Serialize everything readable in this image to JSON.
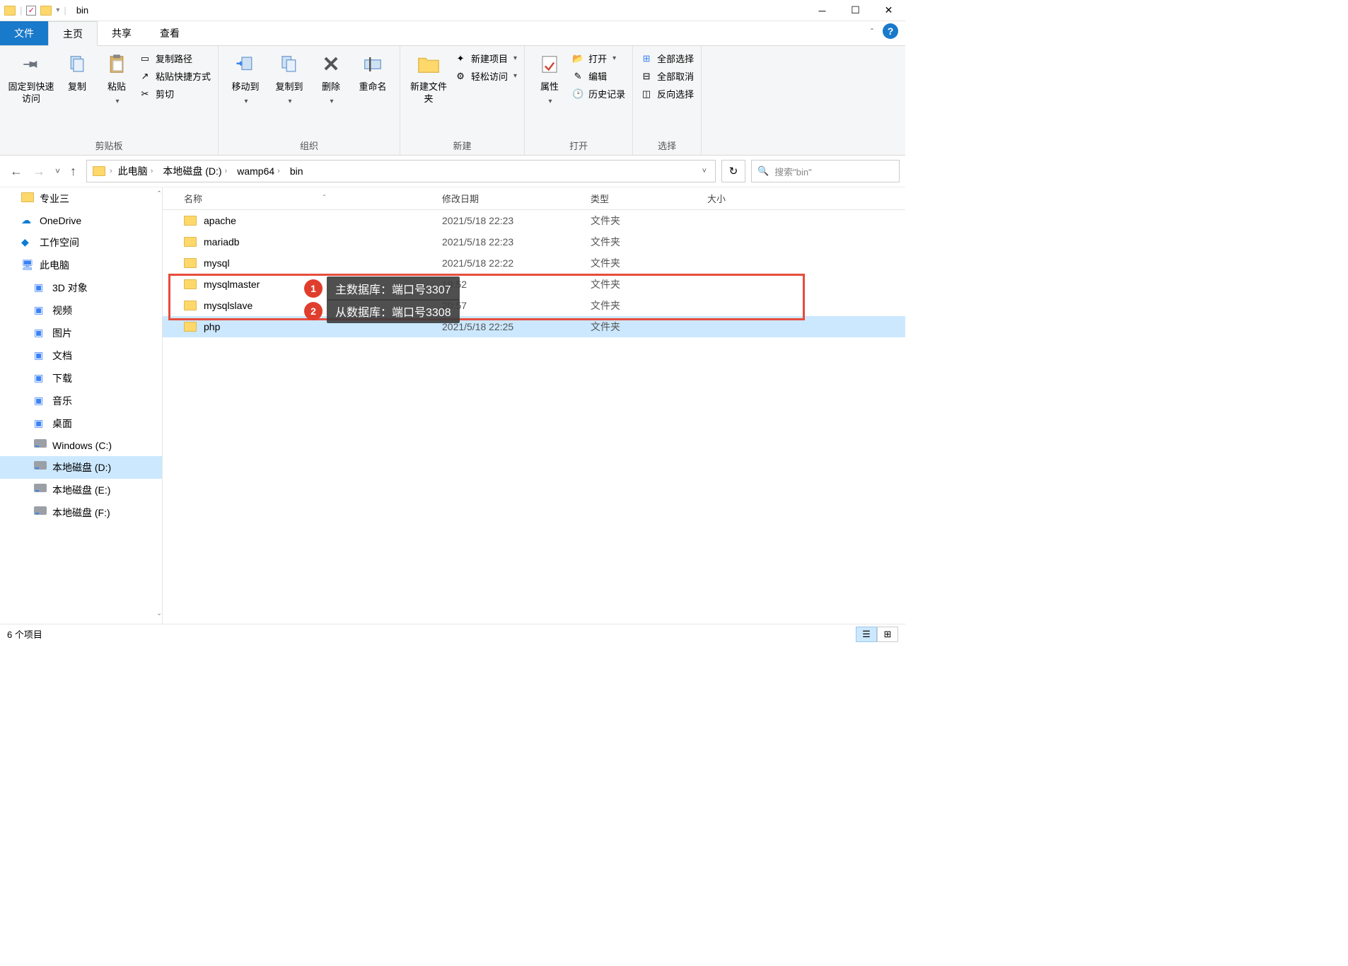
{
  "titlebar": {
    "title": "bin"
  },
  "ribbonTabs": {
    "file": "文件",
    "home": "主页",
    "share": "共享",
    "view": "查看"
  },
  "ribbon": {
    "clipboard": {
      "pin": "固定到快速访问",
      "copy": "复制",
      "paste": "粘贴",
      "copyPath": "复制路径",
      "pasteShortcut": "粘贴快捷方式",
      "cut": "剪切",
      "groupLabel": "剪贴板"
    },
    "organize": {
      "moveTo": "移动到",
      "copyTo": "复制到",
      "delete": "删除",
      "rename": "重命名",
      "groupLabel": "组织"
    },
    "new": {
      "newFolder": "新建文件夹",
      "newItem": "新建项目",
      "easyAccess": "轻松访问",
      "groupLabel": "新建"
    },
    "open": {
      "properties": "属性",
      "open": "打开",
      "edit": "编辑",
      "history": "历史记录",
      "groupLabel": "打开"
    },
    "select": {
      "selectAll": "全部选择",
      "selectNone": "全部取消",
      "invert": "反向选择",
      "groupLabel": "选择"
    }
  },
  "breadcrumb": [
    "此电脑",
    "本地磁盘 (D:)",
    "wamp64",
    "bin"
  ],
  "search": {
    "placeholder": "搜索\"bin\""
  },
  "columns": {
    "name": "名称",
    "date": "修改日期",
    "type": "类型",
    "size": "大小"
  },
  "tree": [
    {
      "label": "专业三",
      "icon": "folder",
      "lvl": 1
    },
    {
      "label": "OneDrive",
      "icon": "cloud",
      "lvl": 1
    },
    {
      "label": "工作空间",
      "icon": "cloud2",
      "lvl": 1
    },
    {
      "label": "此电脑",
      "icon": "pc",
      "lvl": 1
    },
    {
      "label": "3D 对象",
      "icon": "lib",
      "lvl": 2
    },
    {
      "label": "视频",
      "icon": "lib",
      "lvl": 2
    },
    {
      "label": "图片",
      "icon": "lib",
      "lvl": 2
    },
    {
      "label": "文档",
      "icon": "lib",
      "lvl": 2
    },
    {
      "label": "下载",
      "icon": "lib",
      "lvl": 2
    },
    {
      "label": "音乐",
      "icon": "lib",
      "lvl": 2
    },
    {
      "label": "桌面",
      "icon": "lib",
      "lvl": 2
    },
    {
      "label": "Windows (C:)",
      "icon": "drive",
      "lvl": 2
    },
    {
      "label": "本地磁盘 (D:)",
      "icon": "drive",
      "lvl": 2,
      "selected": true
    },
    {
      "label": "本地磁盘 (E:)",
      "icon": "drive",
      "lvl": 2
    },
    {
      "label": "本地磁盘 (F:)",
      "icon": "drive",
      "lvl": 2
    }
  ],
  "files": [
    {
      "name": "apache",
      "date": "2021/5/18 22:23",
      "type": "文件夹"
    },
    {
      "name": "mariadb",
      "date": "2021/5/18 22:23",
      "type": "文件夹"
    },
    {
      "name": "mysql",
      "date": "2021/5/18 22:22",
      "type": "文件夹"
    },
    {
      "name": "mysqlmaster",
      "date": "19:52",
      "type": "文件夹"
    },
    {
      "name": "mysqlslave",
      "date": "20:57",
      "type": "文件夹"
    },
    {
      "name": "php",
      "date": "2021/5/18 22:25",
      "type": "文件夹",
      "selected": true
    }
  ],
  "annotations": [
    {
      "num": "1",
      "text": "主数据库：端口号3307"
    },
    {
      "num": "2",
      "text": "从数据库：端口号3308"
    }
  ],
  "status": {
    "count": "6 个项目"
  }
}
